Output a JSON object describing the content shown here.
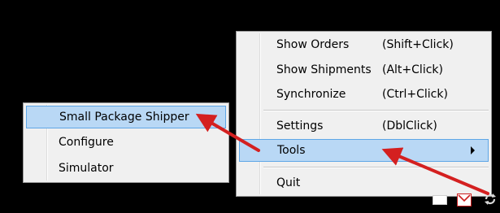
{
  "context_menu": {
    "items": [
      {
        "label": "Show Orders",
        "shortcut": "(Shift+Click)"
      },
      {
        "label": "Show Shipments",
        "shortcut": "(Alt+Click)"
      },
      {
        "label": "Synchronize",
        "shortcut": "(Ctrl+Click)"
      },
      {
        "label": "Settings",
        "shortcut": "(DblClick)"
      },
      {
        "label": "Tools",
        "shortcut": ""
      },
      {
        "label": "Quit",
        "shortcut": ""
      }
    ],
    "highlighted": "Tools"
  },
  "tools_submenu": {
    "items": [
      {
        "label": "Small Package Shipper"
      },
      {
        "label": "Configure"
      },
      {
        "label": "Simulator"
      }
    ],
    "highlighted": "Small Package Shipper"
  },
  "colors": {
    "background": "#000000",
    "menu_bg": "#f0f0f0",
    "highlight_bg": "#b9d8f5",
    "highlight_border": "#5ea6e6",
    "annotation_arrow": "#d42020"
  },
  "tray": {
    "icons": [
      "display-icon",
      "mail-icon",
      "app-tray-icon"
    ]
  }
}
